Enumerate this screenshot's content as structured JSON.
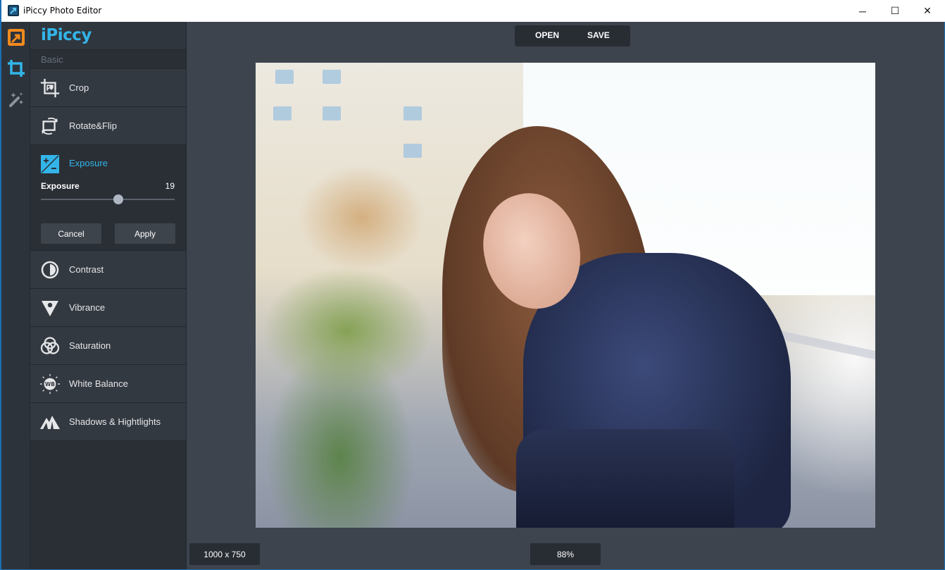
{
  "window": {
    "title": "iPiccy Photo Editor",
    "controls": {
      "minimize": "─",
      "maximize": "☐",
      "close": "✕"
    }
  },
  "rail": {
    "items": [
      {
        "name": "logo",
        "icon": "ipiccy-logo-icon",
        "color": "#f28a1e"
      },
      {
        "name": "basic-tools",
        "icon": "crop-tool-icon",
        "color": "#33b5e9",
        "active": true
      },
      {
        "name": "effects",
        "icon": "magic-wand-icon",
        "color": "#8c939c"
      }
    ]
  },
  "panel": {
    "brand": "iPiccy",
    "section": "Basic",
    "items": [
      {
        "label": "Crop",
        "icon": "crop-icon"
      },
      {
        "label": "Rotate&Flip",
        "icon": "rotate-flip-icon"
      },
      {
        "label": "Exposure",
        "icon": "exposure-icon",
        "expanded": true
      },
      {
        "label": "Contrast",
        "icon": "contrast-icon"
      },
      {
        "label": "Vibrance",
        "icon": "vibrance-icon"
      },
      {
        "label": "Saturation",
        "icon": "saturation-icon"
      },
      {
        "label": "White Balance",
        "icon": "white-balance-icon"
      },
      {
        "label": "Shadows & Hightlights",
        "icon": "shadows-highlights-icon"
      }
    ],
    "exposure": {
      "slider_label": "Exposure",
      "value": "19",
      "slider_fraction": 0.58,
      "cancel": "Cancel",
      "apply": "Apply"
    }
  },
  "toolbar": {
    "open": "OPEN",
    "save": "SAVE"
  },
  "status": {
    "dimensions": "1000 x 750",
    "zoom": "88%"
  },
  "colors": {
    "accent": "#33b5e9",
    "brand_orange": "#f28a1e",
    "window_border": "#1b6fb5"
  }
}
